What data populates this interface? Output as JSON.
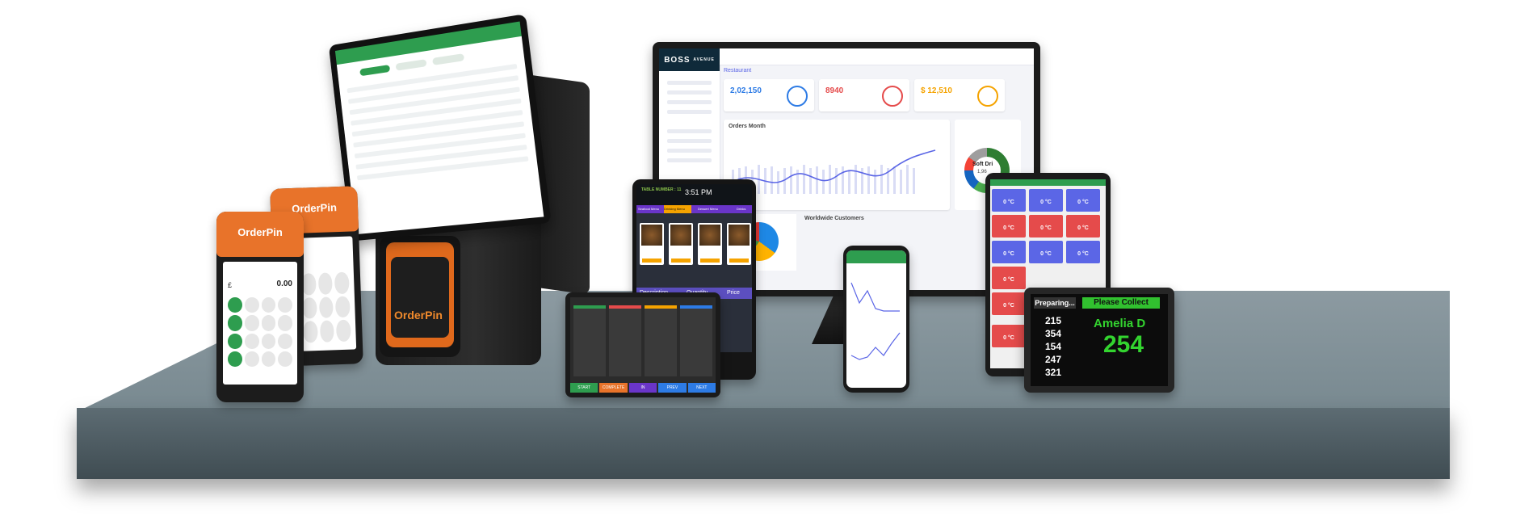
{
  "brand": {
    "orderpin": "OrderPin",
    "boss": "BOSS",
    "boss_sub": "AVENUE"
  },
  "dashboard": {
    "nav_title": "Restaurant",
    "stats": [
      {
        "value": "2,02,150",
        "color": "#2d7be5"
      },
      {
        "value": "8940",
        "color": "#e54b4b"
      },
      {
        "value": "$ 12,510",
        "color": "#f5a300"
      }
    ],
    "chart_title": "Orders Month",
    "donut_label": "Soft Dri",
    "donut_value": "1,96",
    "section": "Worldwide Customers"
  },
  "order_screen": {
    "table": "TABLE NUMBER : 11",
    "time": "3:51 PM",
    "tabs": [
      "Seafood Menu",
      "Drinking Menu",
      "Dessert Menu",
      "Drinks"
    ],
    "columns": [
      "Description",
      "Quantity",
      "Price"
    ]
  },
  "kds": {
    "buttons": [
      "START",
      "COMPLETE",
      "IN PROGRESS",
      "PREV",
      "NEXT"
    ]
  },
  "handheld": {
    "currency": "£",
    "amount": "0.00"
  },
  "temperature": {
    "reading": "0 °C"
  },
  "collect": {
    "preparing_label": "Preparing...",
    "collect_label": "Please Collect",
    "preparing": [
      "215",
      "354",
      "154",
      "247",
      "321"
    ],
    "name": "Amelia D",
    "number": "254"
  },
  "colors": {
    "accent_green": "#2e9d4f",
    "orange": "#e8732a",
    "collect_green": "#33d42f"
  }
}
